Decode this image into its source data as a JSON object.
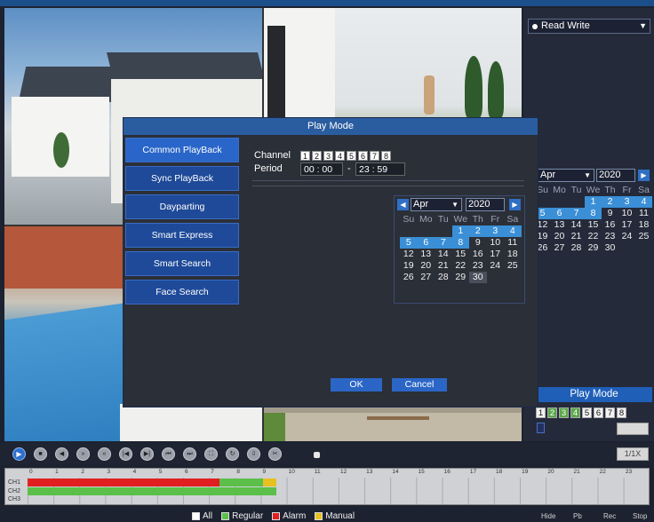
{
  "dialog": {
    "title": "Play Mode",
    "side_buttons": [
      "Common PlayBack",
      "Sync PlayBack",
      "Dayparting",
      "Smart Express",
      "Smart Search",
      "Face Search"
    ],
    "channel_label": "Channel",
    "channels": [
      "1",
      "2",
      "3",
      "4",
      "5",
      "6",
      "7",
      "8"
    ],
    "period_label": "Period",
    "period_start": "00 : 00",
    "period_sep": "-",
    "period_end": "23 : 59",
    "ok_label": "OK",
    "cancel_label": "Cancel",
    "calendar": {
      "month": "Apr",
      "year": "2020",
      "weekdays": [
        "Su",
        "Mo",
        "Tu",
        "We",
        "Th",
        "Fr",
        "Sa"
      ],
      "days": [
        "",
        "",
        "",
        "1",
        "2",
        "3",
        "4",
        "5",
        "6",
        "7",
        "8",
        "9",
        "10",
        "11",
        "12",
        "13",
        "14",
        "15",
        "16",
        "17",
        "18",
        "19",
        "20",
        "21",
        "22",
        "23",
        "24",
        "25",
        "26",
        "27",
        "28",
        "29",
        "30",
        "",
        "",
        ""
      ],
      "highlighted_days": [
        "1",
        "2",
        "3",
        "4",
        "5",
        "6",
        "7",
        "8"
      ],
      "selected_day": "30"
    }
  },
  "right_panel": {
    "mode_select": "Read Write",
    "calendar": {
      "month": "Apr",
      "year": "2020",
      "weekdays": [
        "Su",
        "Mo",
        "Tu",
        "We",
        "Th",
        "Fr",
        "Sa"
      ],
      "days": [
        "",
        "",
        "",
        "1",
        "2",
        "3",
        "4",
        "5",
        "6",
        "7",
        "8",
        "9",
        "10",
        "11",
        "12",
        "13",
        "14",
        "15",
        "16",
        "17",
        "18",
        "19",
        "20",
        "21",
        "22",
        "23",
        "24",
        "25",
        "26",
        "27",
        "28",
        "29",
        "30",
        "",
        "",
        ""
      ],
      "highlighted_days": [
        "1",
        "2",
        "3",
        "4",
        "5",
        "6",
        "7",
        "8"
      ]
    },
    "play_mode_button": "Play Mode",
    "channels": [
      "1",
      "2",
      "3",
      "4",
      "5",
      "6",
      "7",
      "8"
    ],
    "channel_states": [
      "w",
      "g",
      "g",
      "g",
      "w",
      "w",
      "w",
      "w"
    ]
  },
  "controls": {
    "buttons": [
      "play",
      "stop",
      "reverse",
      "slow",
      "fast",
      "prev-frame",
      "next-frame",
      "prev-file",
      "next-file",
      "fullscreen",
      "repeat",
      "backup",
      "clip"
    ],
    "speed_button": "1/1X"
  },
  "timeline": {
    "hour_labels": [
      "0",
      "1",
      "2",
      "3",
      "4",
      "5",
      "6",
      "7",
      "8",
      "9",
      "10",
      "11",
      "12",
      "13",
      "14",
      "15",
      "16",
      "17",
      "18",
      "19",
      "20",
      "21",
      "22",
      "23"
    ],
    "track_labels": [
      "CH1",
      "CH2",
      "CH3"
    ],
    "segments": [
      {
        "type": "alarm",
        "color": "#e02020",
        "start_hour": 0,
        "end_hour": 7.4,
        "row": 1
      },
      {
        "type": "regular",
        "color": "#5cbf4a",
        "start_hour": 7.4,
        "end_hour": 9.6,
        "row": 1
      },
      {
        "type": "manual",
        "color": "#e8c020",
        "start_hour": 9.1,
        "end_hour": 9.6,
        "row": 1
      },
      {
        "type": "regular",
        "color": "#5cbf4a",
        "start_hour": 0,
        "end_hour": 9.6,
        "row": 2
      }
    ]
  },
  "legend": {
    "items": [
      {
        "label": "All",
        "color": "#ffffff"
      },
      {
        "label": "Regular",
        "color": "#5cbf4a"
      },
      {
        "label": "Alarm",
        "color": "#e02020"
      },
      {
        "label": "Manual",
        "color": "#e8c020"
      }
    ]
  },
  "bottom_right_labels": [
    "Hide",
    "Pb",
    "Rec",
    "Stop"
  ]
}
